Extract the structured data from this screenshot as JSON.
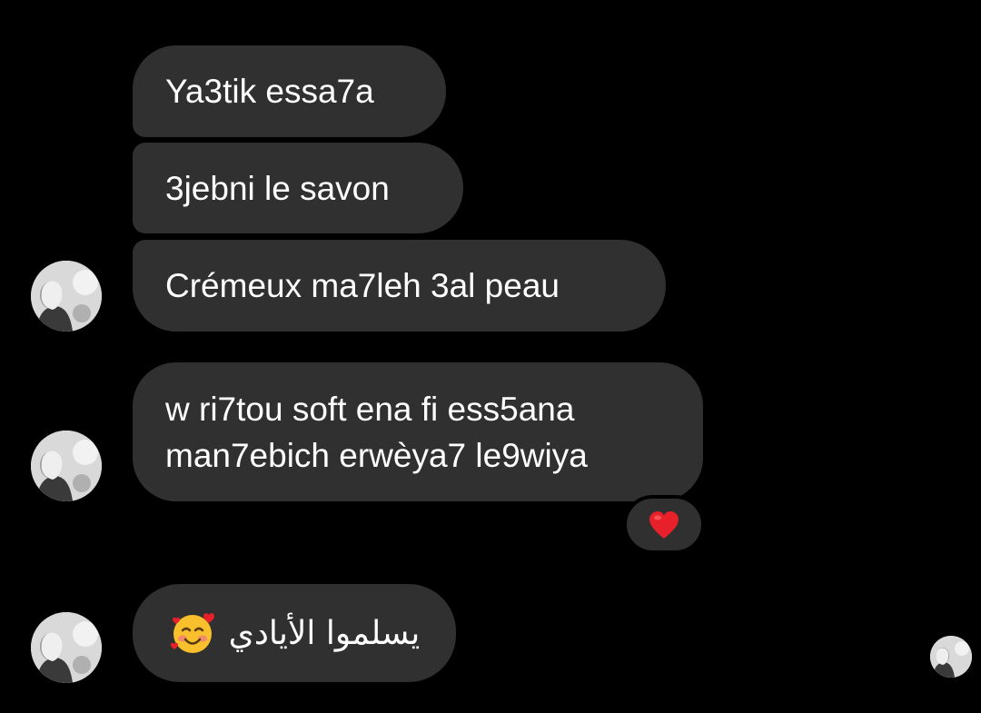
{
  "chat": {
    "messages": [
      {
        "text": "Ya3tik essa7a"
      },
      {
        "text": "3jebni le savon"
      },
      {
        "text": "Crémeux ma7leh 3al peau"
      },
      {
        "line1": "w ri7tou soft ena fi ess5ana",
        "line2": "man7ebich erwèya7 le9wiya",
        "reaction": "heart-icon"
      },
      {
        "text": "يسلموا الأيادي",
        "emoji": "smiling-face-with-hearts-icon"
      }
    ]
  },
  "colors": {
    "background": "#000000",
    "bubble": "#303030",
    "text": "#ffffff",
    "heart": "#e8202a"
  }
}
